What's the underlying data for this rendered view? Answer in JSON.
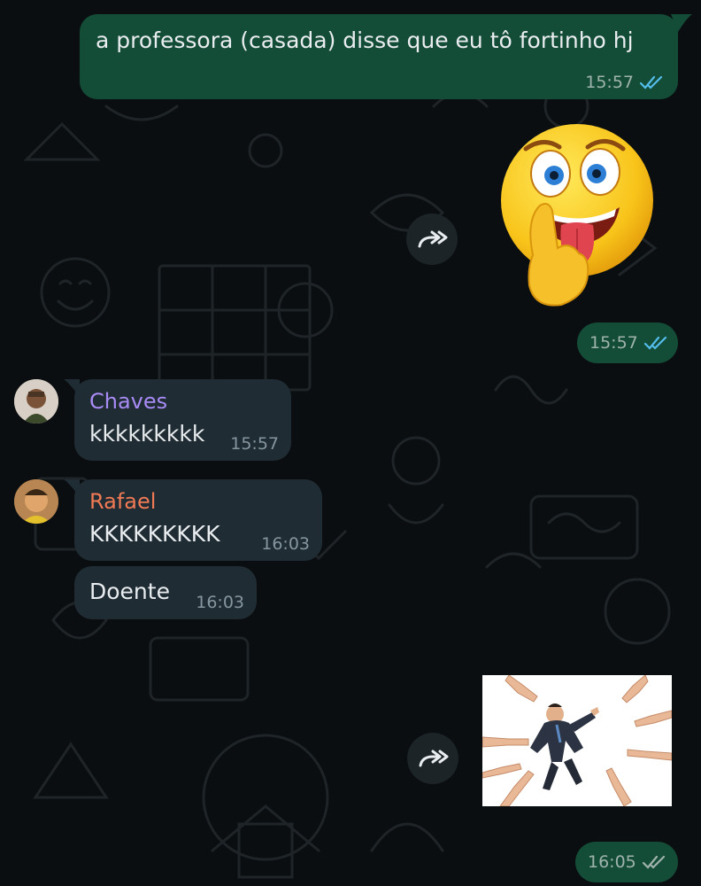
{
  "theme": {
    "background": "#0b0e10",
    "outgoing_bubble": "#144d37",
    "incoming_bubble": "#1f2c33",
    "read_tick_color": "#53bdeb",
    "delivered_tick_color": "#9fb3ad"
  },
  "messages": [
    {
      "direction": "outgoing",
      "type": "text",
      "text": "a professora (casada) disse que eu tô fortinho hj",
      "time": "15:57",
      "status": "read"
    },
    {
      "direction": "outgoing",
      "type": "sticker",
      "sticker_icon": "tongue-out-emoji-sticker",
      "time": "15:57",
      "status": "read",
      "forward_icon": "forward-icon"
    },
    {
      "direction": "incoming",
      "sender": "Chaves",
      "sender_color": "#a88bf5",
      "text": "kkkkkkkkk",
      "time": "15:57"
    },
    {
      "direction": "incoming",
      "sender": "Rafael",
      "sender_color": "#f07a55",
      "text": "KKKKKKKKK",
      "time": "16:03"
    },
    {
      "direction": "incoming",
      "text": "Doente",
      "time": "16:03"
    },
    {
      "direction": "outgoing",
      "type": "image",
      "image_icon": "pointing-fingers-at-man-image",
      "time": "16:05",
      "status": "delivered",
      "forward_icon": "forward-icon"
    }
  ]
}
